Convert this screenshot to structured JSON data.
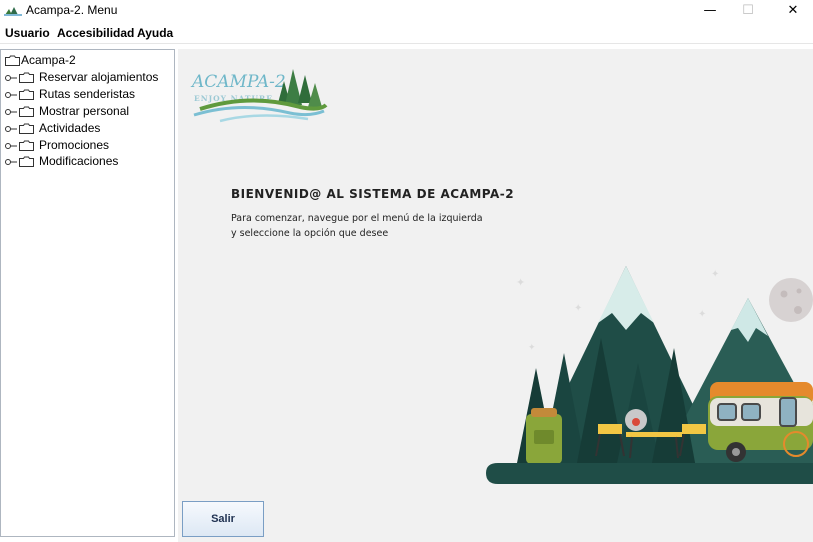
{
  "window": {
    "title": "Acampa-2. Menu",
    "minimize_glyph": "—",
    "maximize_glyph": "☐",
    "close_glyph": "✕"
  },
  "menu": {
    "items": [
      "Usuario",
      "Accesibilidad",
      "Ayuda"
    ]
  },
  "tree": {
    "root": "Acampa-2",
    "items": [
      "Reservar alojamientos",
      "Rutas senderistas",
      "Mostrar personal",
      "Actividades",
      "Promociones",
      "Modificaciones"
    ]
  },
  "logo": {
    "name": "ACAMPA-2",
    "tagline": "ENJOY NATURE"
  },
  "welcome": {
    "title": "BIENVENID@ AL SISTEMA DE ACAMPA-2",
    "line1": "Para comenzar, navegue por el menú de la izquierda",
    "line2": "y seleccione la opción que desee"
  },
  "buttons": {
    "exit": "Salir"
  },
  "colors": {
    "content_background": "#f1f1f1",
    "tree_border": "#aeb6c0",
    "button_border": "#7a9ec4",
    "mountain_dark": "#1f4d47",
    "mountain_light": "#cfe8e6",
    "van_body": "#8aa63a",
    "van_top": "#e58a2c",
    "chair_yellow": "#f2c744"
  }
}
